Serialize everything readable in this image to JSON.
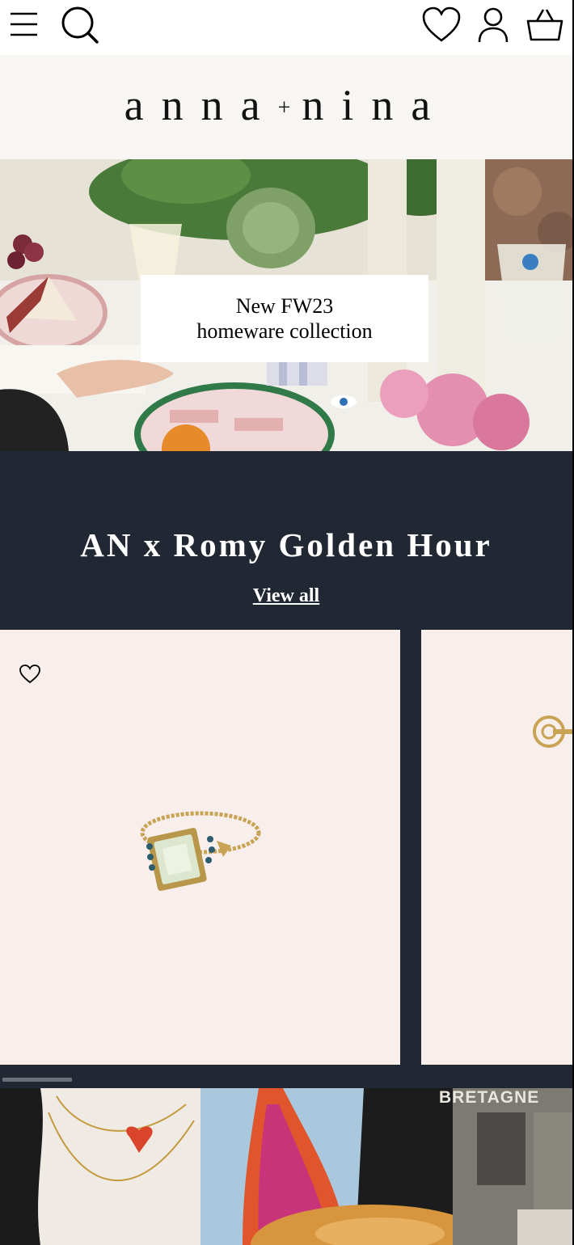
{
  "header": {
    "icons": [
      "menu-icon",
      "search-icon",
      "wishlist-heart-icon",
      "account-icon",
      "basket-icon"
    ]
  },
  "brand": {
    "logo_left": "anna",
    "logo_plus": "+",
    "logo_right": "nina"
  },
  "hero": {
    "line1": "New FW23",
    "line2": "homeware collection"
  },
  "collection": {
    "title": "AN x Romy Golden Hour",
    "view_all": "View all"
  },
  "bottom_banner": {
    "sign_text": "BRETAGNE"
  },
  "colors": {
    "section_bg": "#222833",
    "card_bg": "#f8efec",
    "logo_bg": "#f8f6f3"
  }
}
